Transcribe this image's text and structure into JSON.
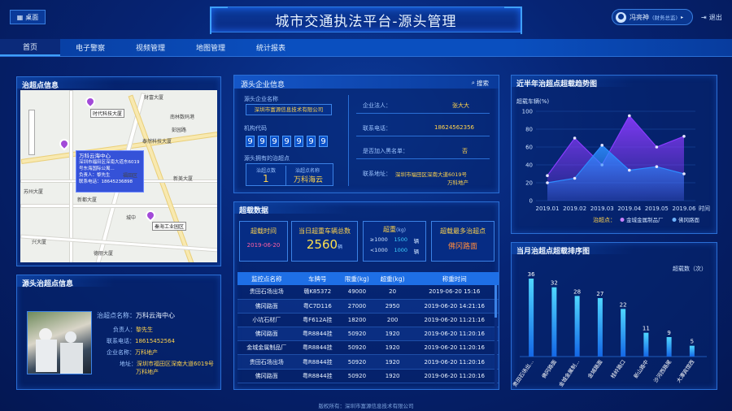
{
  "header": {
    "title": "城市交通执法平台-源头管理",
    "desktop_label": "桌面",
    "user_name": "冯亮神",
    "user_role": "(财务总监)",
    "logout_label": "退出"
  },
  "nav": [
    "首页",
    "电子警察",
    "视频管理",
    "地图管理",
    "统计报表"
  ],
  "map_panel": {
    "title": "治超点信息",
    "labels": [
      "时代科技大厦",
      "财富大厦",
      "万科云海中心",
      "秦海工业园区",
      "彭园路",
      "新美大厦",
      "苏州大厦",
      "新都大厦",
      "泰然科技大厦",
      "德丽大厦",
      "南林数码港",
      "兴大厦",
      "福田区",
      "城中"
    ],
    "popup": {
      "title": "万科云海中心",
      "addr": "深圳市福田区深南大道东6019号东海国际公寓...",
      "person_label": "负责人：",
      "person": "黎先生",
      "phone_label": "联系电话：",
      "phone": "18645236898"
    }
  },
  "source_site": {
    "title": "源头治超点信息",
    "name_label": "治超点名称：",
    "name": "万科云海中心",
    "person_label": "负责人：",
    "person": "黎先生",
    "phone_label": "联系电话：",
    "phone": "18615452564",
    "company_label": "企业名称：",
    "company": "万科地产",
    "addr_label": "地址：",
    "addr1": "深圳市福田区深南大道6019号",
    "addr2": "万科地产"
  },
  "company": {
    "title": "源头企业信息",
    "search_label": "搜索",
    "name_label": "源头企业名称",
    "name": "深圳市富源信息技术有限公司",
    "code_label": "机构代码",
    "code": [
      "9",
      "9",
      "9",
      "9",
      "9",
      "9",
      "9"
    ],
    "own_label": "源头拥有的治超点",
    "count_label": "治超点数",
    "count": "1",
    "site_label": "治超点名称",
    "site": "万科海云",
    "legal_label": "企业法人：",
    "legal": "张大大",
    "phone_label": "联系电话：",
    "phone": "18624562356",
    "black_label": "是否加入黑名单：",
    "black": "否",
    "addr_label": "联系地址：",
    "addr1": "深圳市福田区深南大道6019号",
    "addr2": "万科地产"
  },
  "overload": {
    "title": "超载数据",
    "time_label": "超载时间",
    "time": "2019-06-20",
    "total_label": "当日超重车辆总数",
    "total": "2560",
    "total_unit": "辆",
    "weight_label": "超重",
    "weight_unit": "(kg)",
    "gt_label": "≥1000",
    "gt_val": "1500",
    "gt_unit": "辆",
    "lt_label": "<1000",
    "lt_val": "1000",
    "lt_unit": "辆",
    "most_label": "超载最多治超点",
    "most": "佛冈路面",
    "columns": [
      "监控点名称",
      "车牌号",
      "限重(kg)",
      "超重(kg)",
      "称重时间"
    ],
    "rows": [
      [
        "贵田石场出场",
        "赣K85372",
        "49000",
        "20",
        "2019-06-20 15:16"
      ],
      [
        "佛冈路面",
        "粤C7D116",
        "27000",
        "2950",
        "2019-06-20 14:21:16"
      ],
      [
        "小坑石材厂",
        "粤F612A挂",
        "18200",
        "200",
        "2019-06-20 11:21:16"
      ],
      [
        "佛冈路面",
        "粤R8844挂",
        "50920",
        "1920",
        "2019-06-20 11:20:16"
      ],
      [
        "金城金属制品厂",
        "粤R8844挂",
        "50920",
        "1920",
        "2019-06-20 11:20:16"
      ],
      [
        "贵田石场出场",
        "粤R8844挂",
        "50920",
        "1920",
        "2019-06-20 11:20:16"
      ],
      [
        "佛冈路面",
        "粤R8844挂",
        "50920",
        "1920",
        "2019-06-20 11:20:16"
      ]
    ]
  },
  "trend": {
    "title": "近半年治超点超载趋势图",
    "ylabel": "超载车辆(%)",
    "xlabel": "时间",
    "legend_prefix": "治超点：",
    "chart_data": {
      "type": "area",
      "x": [
        "2019.01",
        "2019.02",
        "2019.03",
        "2019.04",
        "2019.05",
        "2019.06"
      ],
      "ylim": [
        0,
        100
      ],
      "yticks": [
        0,
        20,
        40,
        60,
        80,
        100
      ],
      "series": [
        {
          "name": "金城金属制品厂",
          "values": [
            28,
            70,
            40,
            95,
            60,
            72
          ],
          "color": "#8a3bff"
        },
        {
          "name": "佛冈路面",
          "values": [
            20,
            25,
            62,
            34,
            38,
            30
          ],
          "color": "#2d8cff"
        }
      ]
    }
  },
  "rank": {
    "title": "当月治超点超载排序图",
    "ylabel": "超载数（次）",
    "chart_data": {
      "type": "bar",
      "categories": [
        "贵田石场出...",
        "佛冈路面",
        "金城金属制...",
        "金城路面",
        "桂岭路口",
        "新山路中",
        "沙河西路尾",
        "大潭宾馆西"
      ],
      "values": [
        36,
        32,
        28,
        27,
        22,
        11,
        9,
        5
      ]
    }
  },
  "footer": "版权所有：深圳市富源信息技术有限公司"
}
